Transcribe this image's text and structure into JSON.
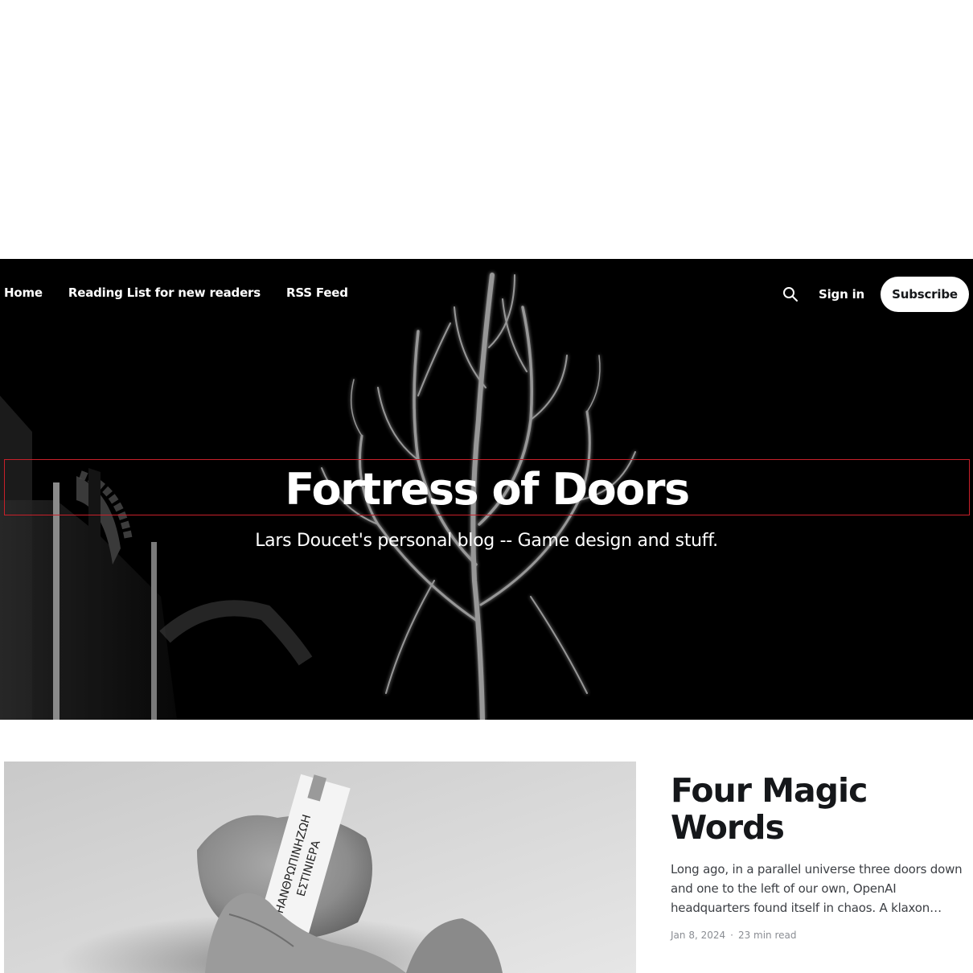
{
  "nav": {
    "items": [
      {
        "label": "Home"
      },
      {
        "label": "Reading List for new readers"
      },
      {
        "label": "RSS Feed"
      }
    ],
    "sign_in_label": "Sign in",
    "subscribe_label": "Subscribe",
    "search_icon": "search-icon"
  },
  "hero": {
    "title": "Fortress of Doors",
    "description": "Lars Doucet's personal blog -- Game design and stuff."
  },
  "featured_post": {
    "title": "Four Magic Words",
    "excerpt": "Long ago, in a parallel universe three doors down and one to the left of our own, OpenAI headquarters found itself in chaos. A klaxon blared...",
    "date": "Jan 8, 2024",
    "meta_separator": "·",
    "read_time": "23 min read",
    "image_text_line1": "ΗΑΝΘΡΩΠΙΝΗΖΩΗ",
    "image_text_line2": "ΕΣΤΙΝΙΕΡΑ"
  },
  "colors": {
    "hero_bg": "#000000",
    "text_dark": "#15171a",
    "meta_gray": "#8a8d93",
    "title_outline": "#c8202a"
  }
}
